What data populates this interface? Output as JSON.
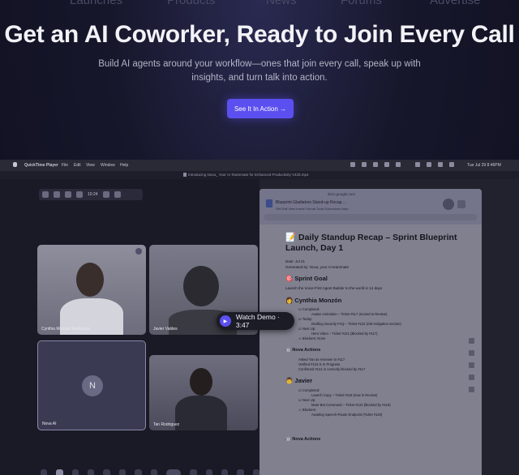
{
  "topnav": [
    "Launches",
    "Products",
    "News",
    "Forums",
    "Advertise"
  ],
  "hero": {
    "title": "Get an AI Coworker, Ready to Join Every Call",
    "subtitle": "Build AI agents around your workflow—ones that join every call, speak up with insights, and turn talk into action.",
    "cta_label": "See It In Action →"
  },
  "mac": {
    "menu": [
      "QuickTime Player",
      "File",
      "Edit",
      "View",
      "Window",
      "Help"
    ],
    "clock": "Tue Jul 29  8:46PM",
    "window_title": "Introducing Nova_ Your AI Teammate for Enhanced Productivity V433.mp4"
  },
  "call": {
    "elapsed": "10:24",
    "participants": [
      {
        "name": "Cynthia Monzón Rodriguez"
      },
      {
        "name": "Javier Valdes"
      },
      {
        "name": "Nova AI",
        "initial": "N"
      },
      {
        "name": "Tan Rodriguez"
      }
    ]
  },
  "watch_demo": {
    "label": "Watch Demo · 3:47"
  },
  "doc": {
    "url": "docs.google.com",
    "tab_title": "Blueprint Gladiators Stand-up Recap ...",
    "menu": "File  Edit  View  Insert  Format  Tools  Extensions  Help",
    "title": "📝 Daily Standup Recap – Sprint Blueprint Launch, Day 1",
    "date": "Date: Jul 21",
    "generated_by": "Generated by: Nova, your AI teammate",
    "goal_heading": "🎯 Sprint Goal",
    "goal_text": "Launch the Voice-First Agent Builder to the world in 14 days",
    "cynthia_heading": "👩 Cynthia Monzón",
    "cynthia_items": [
      "☑ Completed:",
      "Avatar Animation – Ticket #117 (moved to Review)",
      "☑ Today:",
      "Drafting Security FAQ – Ticket #124 (risk-mitigation section)",
      "☑ Next Up:",
      "Hero Video – Ticket #121 (Blocked by #117)",
      "⚠ Blockers: None"
    ],
    "nova_heading": "🤖 Nova Actions",
    "nova_items": [
      "Asked Yan as reviewer to #117",
      "Verified #124 is In Progress",
      "Confirmed #121 is correctly blocked by #117"
    ],
    "javier_heading": "👨 Javier",
    "javier_items": [
      "☑ Completed:",
      "Launch Copy – Ticket #118 (now in Review)",
      "☑ Next Up:",
      "Mute-Bot Command – Ticket #122 (blocked by #119)",
      "⚠ Blockers:",
      "Awaiting Speech-Pause Endpoint (Ticket #119)"
    ],
    "nova_heading_2": "🤖 Nova Actions"
  }
}
